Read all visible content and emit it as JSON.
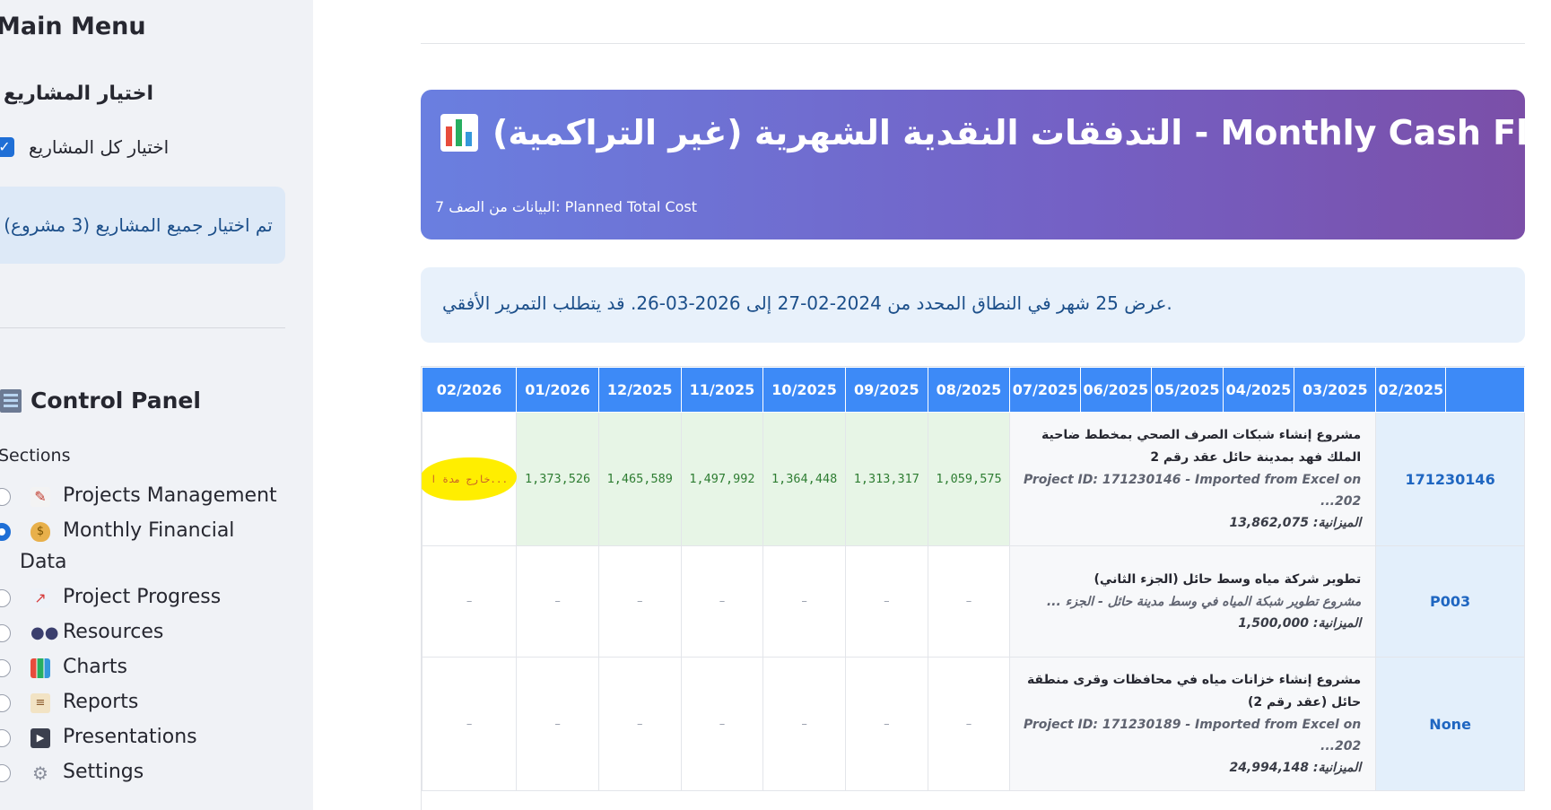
{
  "sidebar": {
    "title": "Main Menu",
    "projects_heading": "اختيار المشاريع",
    "select_all_label": "اختيار كل المشاريع",
    "selection_info": "تم اختيار جميع المشاريع (3 مشروع)",
    "control_panel_title": "Control Panel",
    "sections_label": "Sections",
    "sections": [
      {
        "label": "Projects Management",
        "icon": "memo-icon",
        "selected": false
      },
      {
        "label": "Monthly Financial",
        "label_cont": "Data",
        "icon": "money-bag-icon",
        "selected": true
      },
      {
        "label": "Project Progress",
        "icon": "chart-increasing-icon",
        "selected": false
      },
      {
        "label": "Resources",
        "icon": "people-icon",
        "selected": false
      },
      {
        "label": "Charts",
        "icon": "bar-chart-icon",
        "selected": false
      },
      {
        "label": "Reports",
        "icon": "clipboard-icon",
        "selected": false
      },
      {
        "label": "Presentations",
        "icon": "movie-camera-icon",
        "selected": false
      },
      {
        "label": "Settings",
        "icon": "gear-icon",
        "selected": false
      }
    ]
  },
  "banner": {
    "title": "التدفقات النقدية الشهرية (غير التراكمية) - Monthly Cash Flows",
    "subtitle": "البيانات من الصف 7: Planned Total Cost"
  },
  "range_info": "عرض 25 شهر في النطاق المحدد من 2024-02-27 إلى 2026-03-26. قد يتطلب التمرير الأفقي.",
  "table": {
    "columns": [
      "02/2026",
      "01/2026",
      "12/2025",
      "11/2025",
      "10/2025",
      "09/2025",
      "08/2025",
      "07/2025",
      "06/2025",
      "05/2025",
      "04/2025",
      "03/2025",
      "02/2025"
    ],
    "rows": [
      {
        "id": "171230146",
        "name": "مشروع إنشاء شبكات الصرف الصحي بمخطط ضاحية الملك فهد بمدينة حائل عقد رقم 2",
        "sub": "Project ID: 171230146 - Imported from Excel on 202...",
        "budget": "الميزانية: 13,862,075",
        "out_of_range": "خارج مدة ا...",
        "values": [
          "1,373,526",
          "1,465,589",
          "1,497,992",
          "1,364,448",
          "1,313,317",
          "1,059,575"
        ]
      },
      {
        "id": "P003",
        "name": "تطوير شركة مياه وسط حائل (الجزء الثاني)",
        "sub": "مشروع تطوير شبكة المياه في وسط مدينة حائل - الجزء ...",
        "budget": "الميزانية: 1,500,000",
        "empty": [
          "–",
          "–",
          "–",
          "–",
          "–",
          "–",
          "–"
        ]
      },
      {
        "id": "None",
        "name": "مشروع إنشاء خزانات مياه في محافظات وقرى منطقة حائل (عقد رقم 2)",
        "sub": "Project ID: 171230189 - Imported from Excel on 202...",
        "budget": "الميزانية: 24,994,148",
        "empty": [
          "–",
          "–",
          "–",
          "–",
          "–",
          "–",
          "–"
        ]
      }
    ]
  },
  "colors": {
    "accent": "#1f6fd6",
    "header_blue": "#3d8af7",
    "banner_start": "#6a7fe0",
    "banner_end": "#7b4fa8",
    "value_green": "#2e7d32",
    "highlight_yellow": "#ffee00"
  }
}
